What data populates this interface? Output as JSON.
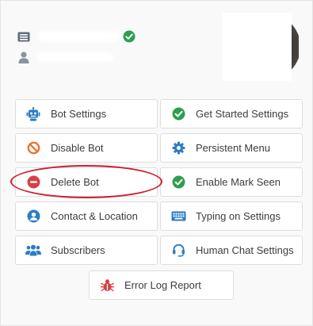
{
  "header": {
    "page_icon": "page-header-icon",
    "verified_icon": "verified-check-icon",
    "user_icon": "user-icon"
  },
  "buttons": {
    "bot_settings": {
      "label": "Bot Settings",
      "icon": "robot-icon"
    },
    "get_started_settings": {
      "label": "Get Started Settings",
      "icon": "check-circle-icon"
    },
    "disable_bot": {
      "label": "Disable Bot",
      "icon": "ban-icon"
    },
    "persistent_menu": {
      "label": "Persistent Menu",
      "icon": "gear-icon"
    },
    "delete_bot": {
      "label": "Delete Bot",
      "icon": "minus-circle-icon"
    },
    "enable_mark_seen": {
      "label": "Enable Mark Seen",
      "icon": "check-circle-icon"
    },
    "contact_location": {
      "label": "Contact & Location",
      "icon": "user-circle-icon"
    },
    "typing_on_settings": {
      "label": "Typing on Settings",
      "icon": "keyboard-icon"
    },
    "subscribers": {
      "label": "Subscribers",
      "icon": "users-icon"
    },
    "human_chat_settings": {
      "label": "Human Chat Settings",
      "icon": "headset-icon"
    },
    "error_log_report": {
      "label": "Error Log Report",
      "icon": "bug-icon"
    }
  },
  "colors": {
    "blue": "#2a7cc7",
    "green": "#2e9e4f",
    "orange": "#e8742c",
    "red": "#d64045",
    "annotation_red": "#cc1f2a"
  }
}
